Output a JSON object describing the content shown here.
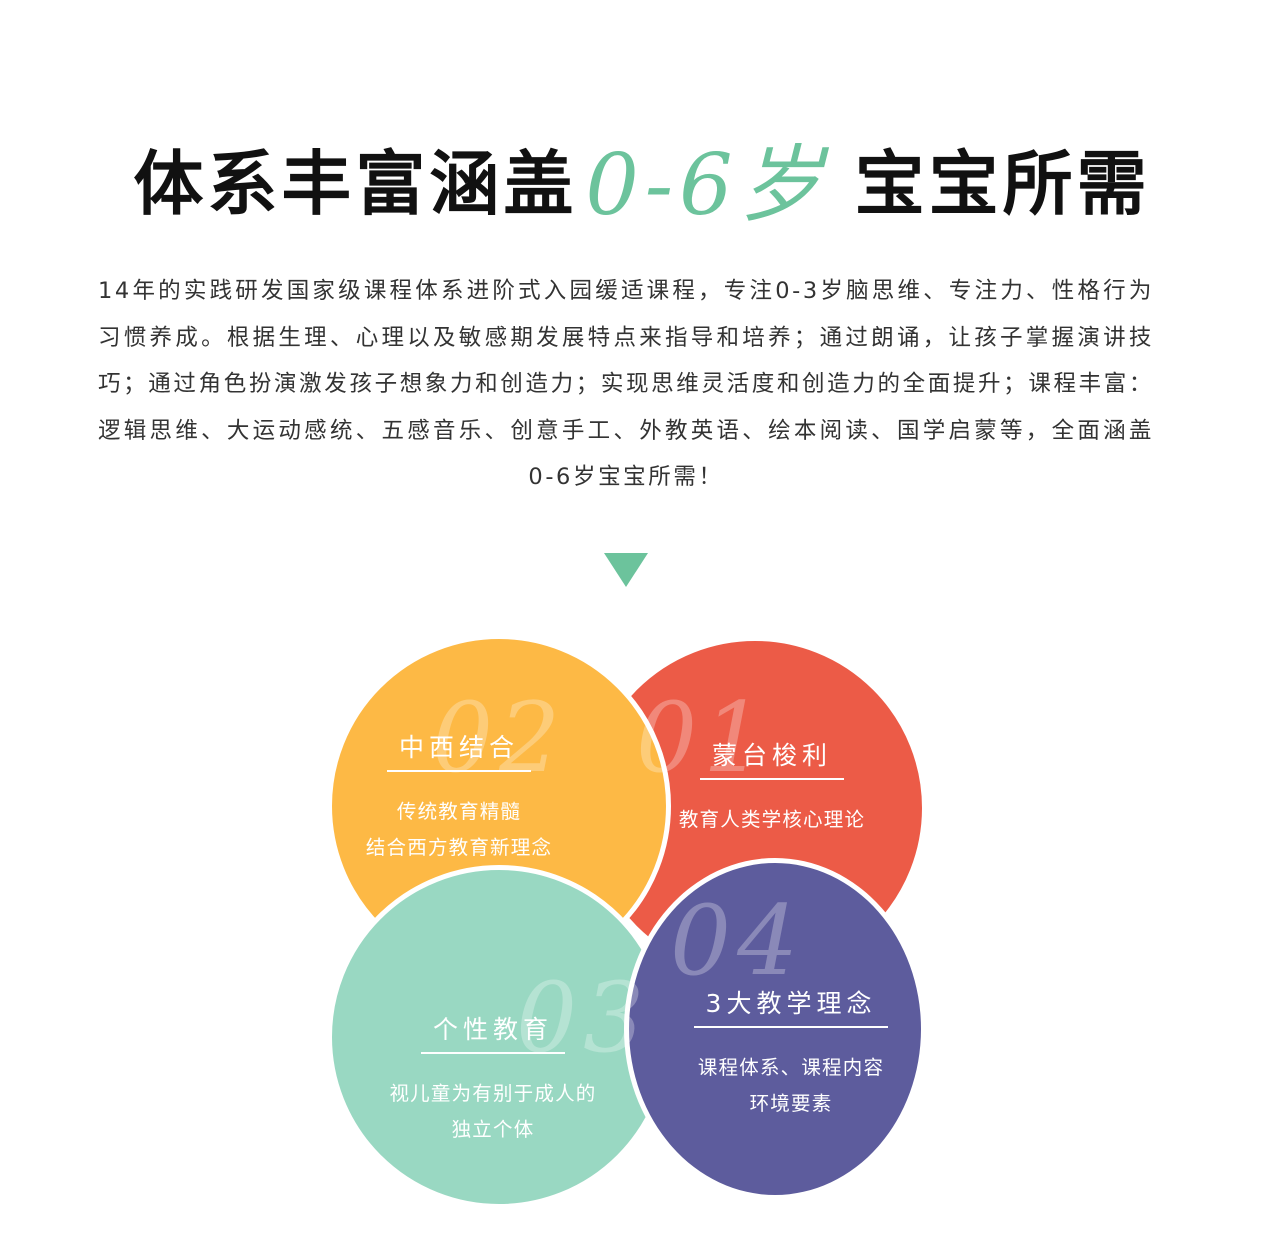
{
  "headline": {
    "part1": "体系丰富涵盖",
    "age": "0-6岁",
    "part2": "宝宝所需"
  },
  "intro": "14年的实践研发国家级课程体系进阶式入园缓适课程，专注0-3岁脑思维、专注力、性格行为习惯养成。根据生理、心理以及敏感期发展特点来指导和培养；通过朗诵，让孩子掌握演讲技巧；通过角色扮演激发孩子想象力和创造力；实现思维灵活度和创造力的全面提升；课程丰富：逻辑思维、大运动感统、五感音乐、创意手工、外教英语、绘本阅读、国学启蒙等，全面涵盖0-6岁宝宝所需！",
  "features": [
    {
      "number": "01",
      "title": "蒙台梭利",
      "lines": [
        "教育人类学核心理论"
      ],
      "color": "#ec5b47"
    },
    {
      "number": "02",
      "title": "中西结合",
      "lines": [
        "传统教育精髓",
        "结合西方教育新理念"
      ],
      "color": "#fdb945"
    },
    {
      "number": "03",
      "title": "个性教育",
      "lines": [
        "视儿童为有别于成人的",
        "独立个体"
      ],
      "color": "#99d8c2"
    },
    {
      "number": "04",
      "title": "3大教学理念",
      "lines": [
        "课程体系、课程内容",
        "环境要素"
      ],
      "color": "#5d5c9d"
    }
  ],
  "colors": {
    "accent_green": "#6cc39c",
    "text_dark": "#111111"
  },
  "icons": {
    "arrow": "down-triangle-icon"
  }
}
